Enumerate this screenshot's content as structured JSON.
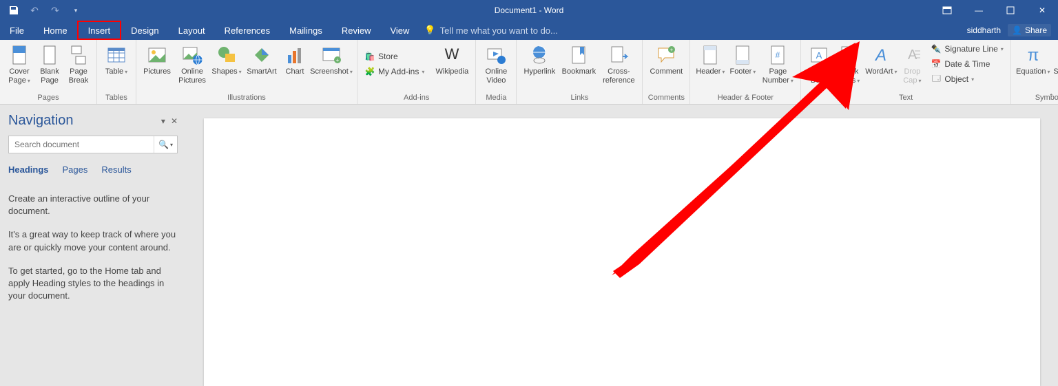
{
  "title": "Document1 - Word",
  "user": "siddharth",
  "share": "Share",
  "tabs": [
    "File",
    "Home",
    "Insert",
    "Design",
    "Layout",
    "References",
    "Mailings",
    "Review",
    "View"
  ],
  "tellme": "Tell me what you want to do...",
  "ribbon": {
    "pages": {
      "label": "Pages",
      "cover": "Cover Page",
      "blank": "Blank Page",
      "break": "Page Break"
    },
    "tables": {
      "label": "Tables",
      "table": "Table"
    },
    "illustrations": {
      "label": "Illustrations",
      "pictures": "Pictures",
      "online_pictures": "Online Pictures",
      "shapes": "Shapes",
      "smartart": "SmartArt",
      "chart": "Chart",
      "screenshot": "Screenshot"
    },
    "addins": {
      "label": "Add-ins",
      "store": "Store",
      "myaddins": "My Add-ins",
      "wikipedia": "Wikipedia"
    },
    "media": {
      "label": "Media",
      "video": "Online Video"
    },
    "links": {
      "label": "Links",
      "hyperlink": "Hyperlink",
      "bookmark": "Bookmark",
      "crossref": "Cross-reference"
    },
    "comments": {
      "label": "Comments",
      "comment": "Comment"
    },
    "headerfooter": {
      "label": "Header & Footer",
      "header": "Header",
      "footer": "Footer",
      "pagenum": "Page Number"
    },
    "text": {
      "label": "Text",
      "textbox": "Text Box",
      "quickparts": "Quick Parts",
      "wordart": "WordArt",
      "dropcap": "Drop Cap",
      "sigline": "Signature Line",
      "datetime": "Date & Time",
      "object": "Object"
    },
    "symbols": {
      "label": "Symbols",
      "equation": "Equation",
      "symbol": "Symbol"
    }
  },
  "nav": {
    "title": "Navigation",
    "search_placeholder": "Search document",
    "tabs": {
      "headings": "Headings",
      "pages": "Pages",
      "results": "Results"
    },
    "p1": "Create an interactive outline of your document.",
    "p2": "It's a great way to keep track of where you are or quickly move your content around.",
    "p3": "To get started, go to the Home tab and apply Heading styles to the headings in your document."
  }
}
